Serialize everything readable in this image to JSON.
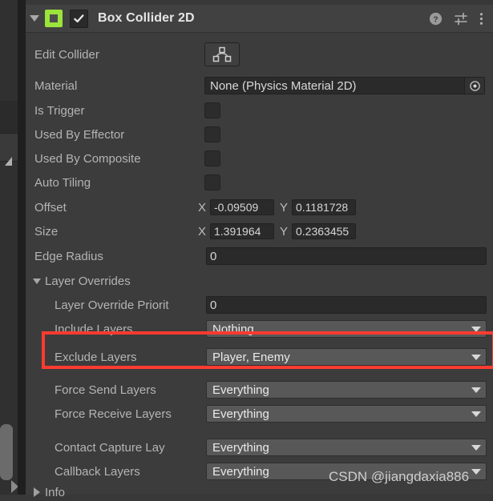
{
  "component": {
    "title": "Box Collider 2D",
    "enabled": true,
    "icon": "box-collider-2d-icon",
    "header_icons": [
      "help-icon",
      "preset-icon",
      "more-menu-icon"
    ]
  },
  "rows": {
    "edit_collider": {
      "label": "Edit Collider",
      "button_icon": "edit-collider-icon"
    },
    "material": {
      "label": "Material",
      "value": "None (Physics Material 2D)",
      "picker_icon": "object-picker-icon"
    },
    "is_trigger": {
      "label": "Is Trigger",
      "checked": false
    },
    "used_by_effector": {
      "label": "Used By Effector",
      "checked": false
    },
    "used_by_composite": {
      "label": "Used By Composite",
      "checked": false
    },
    "auto_tiling": {
      "label": "Auto Tiling",
      "checked": false
    },
    "offset": {
      "label": "Offset",
      "x_label": "X",
      "x_value": "-0.09509",
      "y_label": "Y",
      "y_value": "0.1181728"
    },
    "size": {
      "label": "Size",
      "x_label": "X",
      "x_value": "1.391964",
      "y_label": "Y",
      "y_value": "0.2363455"
    },
    "edge_radius": {
      "label": "Edge Radius",
      "value": "0"
    }
  },
  "layer_overrides": {
    "label": "Layer Overrides",
    "expanded": true,
    "priority": {
      "label": "Layer Override Priorit",
      "value": "0"
    },
    "include_layers": {
      "label": "Include Layers",
      "value": "Nothing"
    },
    "exclude_layers": {
      "label": "Exclude Layers",
      "value": "Player, Enemy"
    },
    "force_send_layers": {
      "label": "Force Send Layers",
      "value": "Everything"
    },
    "force_receive_layers": {
      "label": "Force Receive Layers",
      "value": "Everything"
    },
    "contact_capture_layers": {
      "label": "Contact Capture Lay",
      "value": "Everything"
    },
    "callback_layers": {
      "label": "Callback Layers",
      "value": "Everything"
    }
  },
  "info": {
    "label": "Info",
    "expanded": false
  },
  "annotation": {
    "color": "#ff3b30",
    "target": "exclude-layers-row"
  },
  "watermark": {
    "text": "CSDN @jiangdaxia886"
  }
}
